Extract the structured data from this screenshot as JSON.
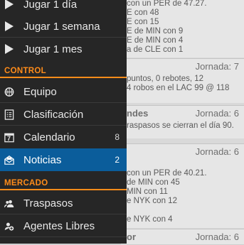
{
  "drawer": {
    "play_items": [
      {
        "label": "Jugar 1 día"
      },
      {
        "label": "Jugar 1 semana"
      },
      {
        "label": "Jugar 1 mes"
      }
    ],
    "sections": {
      "control": "CONTROL",
      "mercado": "MERCADO"
    },
    "control_items": [
      {
        "label": "Equipo",
        "icon": "basketball-icon",
        "count": ""
      },
      {
        "label": "Clasificación",
        "icon": "list-icon",
        "count": ""
      },
      {
        "label": "Calendario",
        "icon": "calendar-icon",
        "count": "8"
      },
      {
        "label": "Noticias",
        "icon": "mail-icon",
        "count": "2",
        "active": true
      }
    ],
    "mercado_items": [
      {
        "label": "Traspasos",
        "icon": "users-icon"
      },
      {
        "label": "Agentes Libres",
        "icon": "add-user-icon"
      }
    ],
    "calendar_day": "7",
    "accent_color": "#ff8c1a",
    "active_color": "#0b5d9b"
  },
  "news": {
    "card0": {
      "lines": [
        "con un PER de 47.27.",
        "E con 48",
        "E con 15",
        "E de MIN con 9",
        "E de MIN con 4",
        "a de CLE con 1"
      ]
    },
    "card1": {
      "jornada": "Jornada: 7",
      "lines": [
        "puntos, 0 rebotes, 12",
        "4 robos en el LAC 99 @ 118"
      ]
    },
    "card2": {
      "title": "ndes",
      "jornada": "Jornada: 6",
      "lines": [
        "raspasos se cierran el día 90."
      ]
    },
    "card3": {
      "jornada": "Jornada: 6",
      "lines": [
        "",
        "con un PER de 40.21.",
        "de MIN con 45",
        "MIN con 11",
        "e NYK con 12",
        "",
        "e NYK con 4"
      ]
    },
    "card4": {
      "title": "or",
      "jornada": "Jornada: 6"
    }
  }
}
